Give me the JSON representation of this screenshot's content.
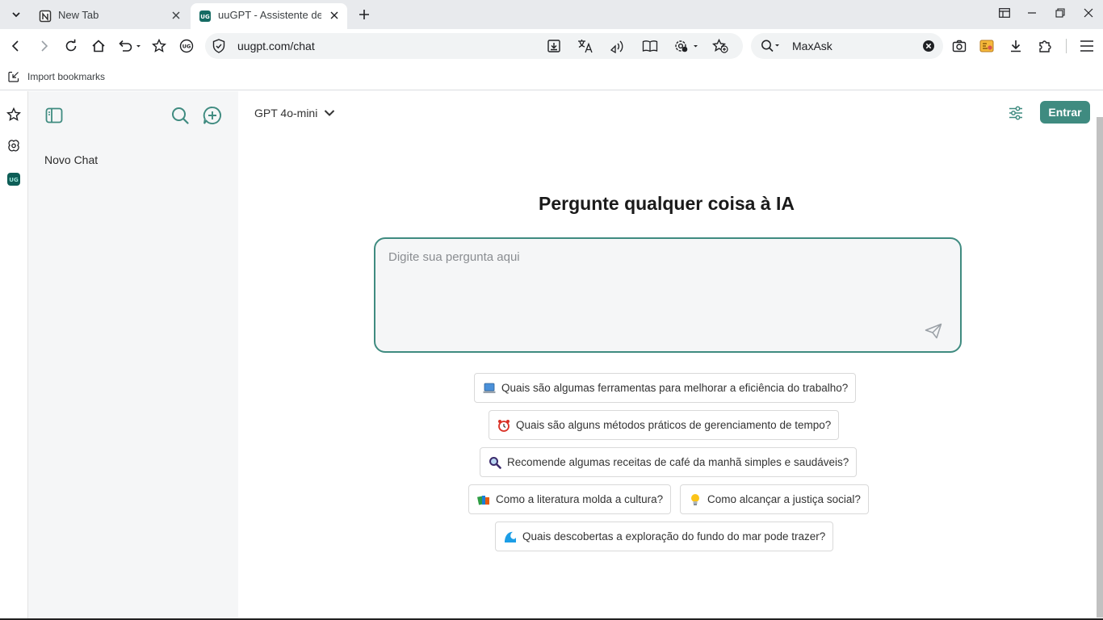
{
  "browser": {
    "tabs": [
      {
        "title": "New Tab",
        "favicon": "notion-icon",
        "active": false
      },
      {
        "title": "uuGPT - Assistente de C",
        "favicon": "uugpt-icon",
        "active": true
      }
    ],
    "url": "uugpt.com/chat",
    "search_engine_label": "MaxAsk",
    "bookmarks": [
      {
        "label": "Import bookmarks",
        "icon": "import-icon"
      }
    ],
    "uugpt_badge": "UG"
  },
  "app": {
    "sidebar": {
      "chats": [
        {
          "label": "Novo Chat"
        }
      ]
    },
    "header": {
      "model_label": "GPT 4o-mini",
      "login_label": "Entrar"
    },
    "hero": {
      "title": "Pergunte qualquer coisa à IA",
      "prompt_placeholder": "Digite sua pergunta aqui"
    },
    "suggestions": [
      {
        "emoji": "laptop",
        "text": "Quais são algumas ferramentas para melhorar a eficiência do trabalho?"
      },
      {
        "emoji": "alarm-clock",
        "text": "Quais são alguns métodos práticos de gerenciamento de tempo?"
      },
      {
        "emoji": "magnifier",
        "text": "Recomende algumas receitas de café da manhã simples e saudáveis?"
      },
      {
        "emoji": "books",
        "text": "Como a literatura molda a cultura?"
      },
      {
        "emoji": "light-bulb",
        "text": "Como alcançar a justiça social?"
      },
      {
        "emoji": "wave",
        "text": "Quais descobertas a exploração do fundo do mar pode trazer?"
      }
    ],
    "colors": {
      "accent": "#3f8b80",
      "sidebar_bg": "#f5f6f7"
    }
  }
}
